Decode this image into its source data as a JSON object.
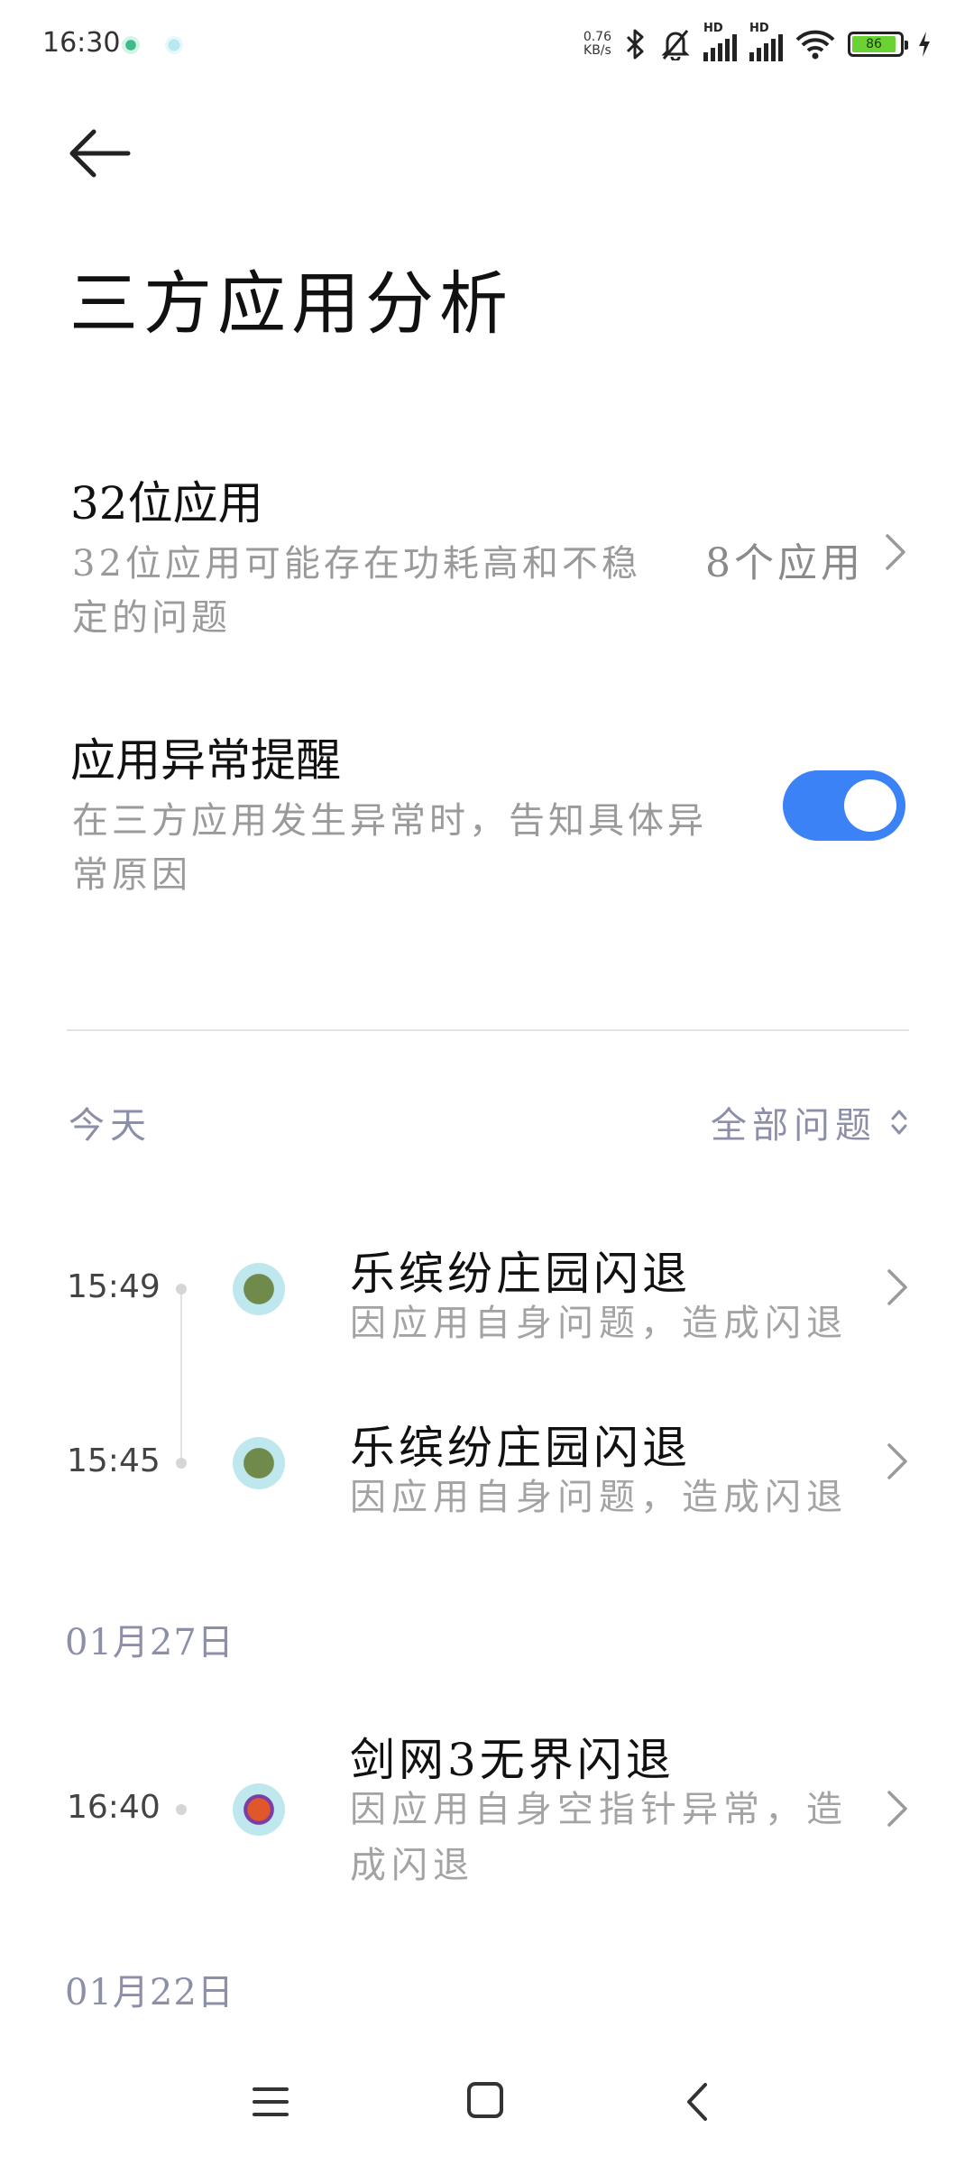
{
  "status_bar": {
    "time": "16:30",
    "net_speed_value": "0.76",
    "net_speed_unit": "KB/s",
    "hd1": "HD",
    "hd2": "HD",
    "battery_level": "86",
    "icons": [
      "bluetooth-icon",
      "mute-bell-icon",
      "signal-icon",
      "signal-icon",
      "wifi-icon",
      "battery-icon",
      "charging-icon"
    ]
  },
  "header": {
    "title": "三方应用分析"
  },
  "settings": {
    "apps32": {
      "title": "32位应用",
      "desc_line1": "32位应用可能存在功耗高和不稳",
      "desc_line2": "定的问题",
      "value": "8个应用"
    },
    "anomaly_reminder": {
      "title": "应用异常提醒",
      "desc_line1": "在三方应用发生异常时，告知具体异",
      "desc_line2": "常原因",
      "enabled": true,
      "accent": "#3b82f6"
    }
  },
  "history": {
    "filter_label": "全部问题",
    "groups": [
      {
        "date": "今天",
        "events": [
          {
            "time": "15:49",
            "title": "乐缤纷庄园闪退",
            "desc": "因应用自身问题，造成闪退"
          },
          {
            "time": "15:45",
            "title": "乐缤纷庄园闪退",
            "desc": "因应用自身问题，造成闪退"
          }
        ]
      },
      {
        "date": "01月27日",
        "events": [
          {
            "time": "16:40",
            "title": "剑网3无界闪退",
            "desc_line1": "因应用自身空指针异常，造",
            "desc_line2": "成闪退"
          }
        ]
      },
      {
        "date": "01月22日",
        "events": []
      }
    ]
  },
  "nav_bar": {
    "icons": [
      "menu-icon",
      "home-square-icon",
      "back-chevron-icon"
    ]
  }
}
